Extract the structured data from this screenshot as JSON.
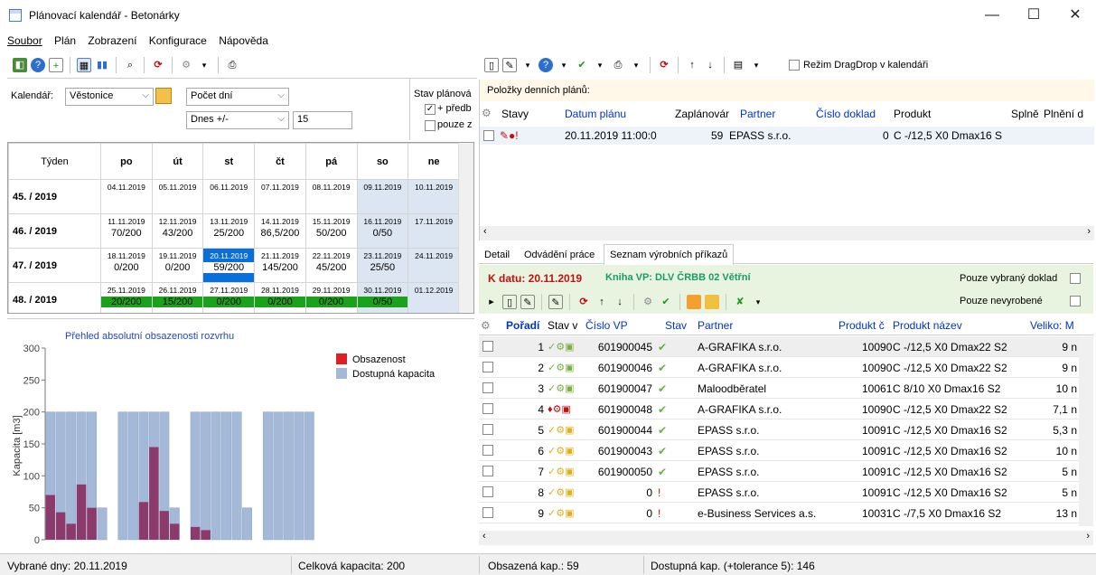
{
  "window": {
    "title": "Plánovací kalendář - Betonárky",
    "minimize": "—",
    "maximize": "☐",
    "close": "✕"
  },
  "menu": [
    "Soubor",
    "Plán",
    "Zobrazení",
    "Konfigurace",
    "Nápověda"
  ],
  "filters": {
    "calendar_label": "Kalendář:",
    "calendar_value": "Věstonice",
    "mode_value": "Počet dní",
    "today_value": "Dnes +/-",
    "days_value": "15",
    "plan_state_label": "Stav plánová",
    "opt1_label": "+ předb",
    "opt2_label": "pouze z"
  },
  "calendar": {
    "headers": [
      "Týden",
      "po",
      "út",
      "st",
      "čt",
      "pá",
      "so",
      "ne"
    ],
    "weeks": [
      {
        "week": "45. / 2019",
        "dates": [
          "04.11.2019",
          "05.11.2019",
          "06.11.2019",
          "07.11.2019",
          "08.11.2019",
          "09.11.2019",
          "10.11.2019"
        ],
        "caps": [
          "",
          "",
          "",
          "",
          "",
          "",
          ""
        ]
      },
      {
        "week": "46. / 2019",
        "dates": [
          "11.11.2019",
          "12.11.2019",
          "13.11.2019",
          "14.11.2019",
          "15.11.2019",
          "16.11.2019",
          "17.11.2019"
        ],
        "caps": [
          "70/200",
          "43/200",
          "25/200",
          "86,5/200",
          "50/200",
          "0/50",
          ""
        ]
      },
      {
        "week": "47. / 2019",
        "dates": [
          "18.11.2019",
          "19.11.2019",
          "20.11.2019",
          "21.11.2019",
          "22.11.2019",
          "23.11.2019",
          "24.11.2019"
        ],
        "caps": [
          "0/200",
          "0/200",
          "59/200",
          "145/200",
          "45/200",
          "25/50",
          ""
        ]
      },
      {
        "week": "48. / 2019",
        "dates": [
          "25.11.2019",
          "26.11.2019",
          "27.11.2019",
          "28.11.2019",
          "29.11.2019",
          "30.11.2019",
          "01.12.2019"
        ],
        "caps": [
          "20/200",
          "15/200",
          "0/200",
          "0/200",
          "0/200",
          "0/50",
          ""
        ]
      }
    ]
  },
  "chart_data": {
    "type": "bar",
    "title": "Přehled absolutní obsazenosti rozvrhu",
    "ylabel": "Kapacita [m3]",
    "ylim": [
      0,
      300
    ],
    "yticks": [
      0,
      50,
      100,
      150,
      200,
      250,
      300
    ],
    "series": [
      {
        "name": "Obsazenost",
        "color": "#8b3a6b",
        "values": [
          70,
          43,
          25,
          86.5,
          50,
          0,
          0,
          0,
          0,
          59,
          145,
          45,
          25,
          0,
          20,
          15,
          0,
          0,
          0,
          0,
          0,
          0,
          0,
          0,
          0,
          0
        ]
      },
      {
        "name": "Dostupná kapacita",
        "color": "#a4b8d8",
        "values": [
          200,
          200,
          200,
          200,
          200,
          50,
          0,
          200,
          200,
          200,
          200,
          200,
          50,
          0,
          200,
          200,
          200,
          200,
          200,
          50,
          0,
          200,
          200,
          200,
          200,
          200
        ]
      }
    ]
  },
  "right_top": {
    "dragdrop_label": "Režim DragDrop v kalendáři",
    "section_label": "Položky denních plánů:",
    "columns": [
      "Stavy",
      "Datum plánu",
      "Zaplánovár",
      "Partner",
      "Číslo doklad",
      "Produkt",
      "Splně",
      "Plnění d"
    ],
    "row": {
      "date": "20.11.2019 11:00:0",
      "planned": "59",
      "partner": "EPASS s.r.o.",
      "doc": "0",
      "product": "C -/12,5 X0 Dmax16 S"
    }
  },
  "tabs": [
    "Detail",
    "Odvádění práce",
    "Seznam výrobních příkazů"
  ],
  "orders": {
    "date_label": "K datu: 20.11.2019",
    "book_label": "Kniha VP: DLV ČRBB 02 Větřní",
    "only_selected": "Pouze vybraný doklad",
    "only_unproduced": "Pouze nevyrobené",
    "columns": [
      "Pořadí",
      "Stav v",
      "Číslo VP",
      "Stav",
      "Partner",
      "Produkt č",
      "Produkt název",
      "Veliko: M"
    ],
    "rows": [
      {
        "order": "1",
        "vp": "601900045",
        "partner": "A-GRAFIKA s.r.o.",
        "pc": "10090",
        "pname": "C -/12,5 X0 Dmax22 S2",
        "size": "9 n"
      },
      {
        "order": "2",
        "vp": "601900046",
        "partner": "A-GRAFIKA s.r.o.",
        "pc": "10090",
        "pname": "C -/12,5 X0 Dmax22 S2",
        "size": "9 n"
      },
      {
        "order": "3",
        "vp": "601900047",
        "partner": "Maloodběratel",
        "pc": "10061",
        "pname": "C  8/10 X0 Dmax16 S2",
        "size": "10 n"
      },
      {
        "order": "4",
        "vp": "601900048",
        "partner": "A-GRAFIKA s.r.o.",
        "pc": "10090",
        "pname": "C -/12,5 X0 Dmax22 S2",
        "size": "7,1 n"
      },
      {
        "order": "5",
        "vp": "601900044",
        "partner": "EPASS s.r.o.",
        "pc": "10091",
        "pname": "C -/12,5 X0 Dmax16 S2",
        "size": "5,3 n"
      },
      {
        "order": "6",
        "vp": "601900043",
        "partner": "EPASS s.r.o.",
        "pc": "10091",
        "pname": "C -/12,5 X0 Dmax16 S2",
        "size": "10 n"
      },
      {
        "order": "7",
        "vp": "601900050",
        "partner": "EPASS s.r.o.",
        "pc": "10091",
        "pname": "C -/12,5 X0 Dmax16 S2",
        "size": "5 n"
      },
      {
        "order": "8",
        "vp": "0",
        "partner": "EPASS s.r.o.",
        "pc": "10091",
        "pname": "C -/12,5 X0 Dmax16 S2",
        "size": "5 n"
      },
      {
        "order": "9",
        "vp": "0",
        "partner": "e-Business Services a.s.",
        "pc": "10031",
        "pname": "C  -/7,5 X0 Dmax16 S2",
        "size": "13 n"
      }
    ]
  },
  "status": {
    "selected": "Vybrané dny: 20.11.2019",
    "total": "Celková kapacita: 200",
    "occupied": "Obsazená kap.: 59",
    "available": "Dostupná kap. (+tolerance 5): 146"
  }
}
